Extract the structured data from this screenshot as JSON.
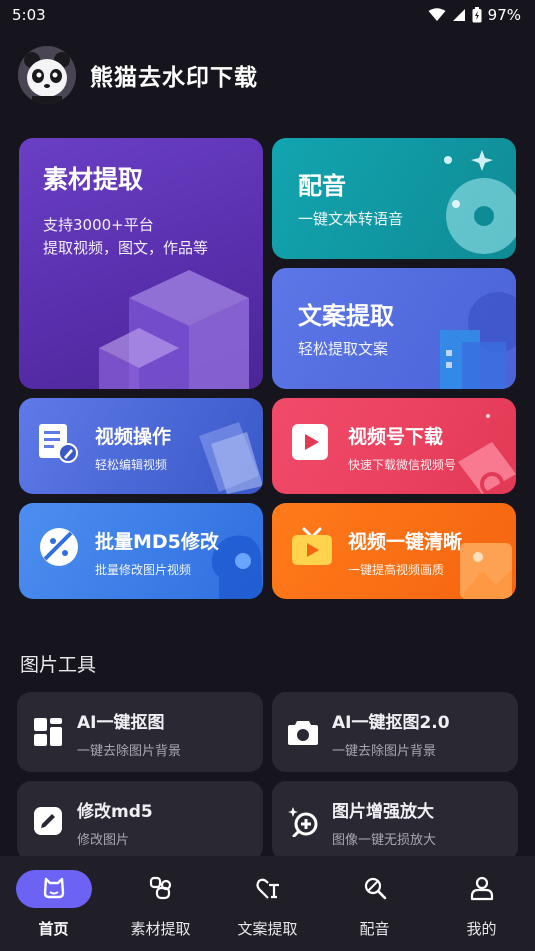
{
  "status_bar": {
    "time": "5:03",
    "battery": "97%"
  },
  "header": {
    "title": "熊猫去水印下载"
  },
  "features": {
    "material": {
      "title": "素材提取",
      "line1": "支持3000+平台",
      "line2": "提取视频，图文，作品等"
    },
    "dubbing": {
      "title": "配音",
      "subtitle": "一键文本转语音"
    },
    "copywriting": {
      "title": "文案提取",
      "subtitle": "轻松提取文案"
    },
    "video_ops": {
      "title": "视频操作",
      "subtitle": "轻松编辑视频"
    },
    "channel_download": {
      "title": "视频号下载",
      "subtitle": "快速下载微信视频号"
    },
    "batch_md5": {
      "title": "批量MD5修改",
      "subtitle": "批量修改图片视频"
    },
    "video_clear": {
      "title": "视频一键清晰",
      "subtitle": "一键提高视频画质"
    }
  },
  "image_tools": {
    "section_title": "图片工具",
    "items": [
      {
        "title": "AI一键抠图",
        "subtitle": "一键去除图片背景",
        "icon": "grid-icon"
      },
      {
        "title": "AI一键抠图2.0",
        "subtitle": "一键去除图片背景",
        "icon": "camera-icon"
      },
      {
        "title": "修改md5",
        "subtitle": "修改图片",
        "icon": "edit-icon"
      },
      {
        "title": "图片增强放大",
        "subtitle": "图像一键无损放大",
        "icon": "zoom-plus-icon"
      }
    ]
  },
  "bottom_nav": {
    "items": [
      {
        "label": "首页",
        "icon": "home-icon",
        "active": true
      },
      {
        "label": "素材提取",
        "icon": "material-icon"
      },
      {
        "label": "文案提取",
        "icon": "text-extract-icon"
      },
      {
        "label": "配音",
        "icon": "mic-icon"
      },
      {
        "label": "我的",
        "icon": "profile-icon"
      }
    ]
  },
  "colors": {
    "background": "#16151d",
    "nav_active": "#6c63f5",
    "tool_card": "#2a2832"
  }
}
